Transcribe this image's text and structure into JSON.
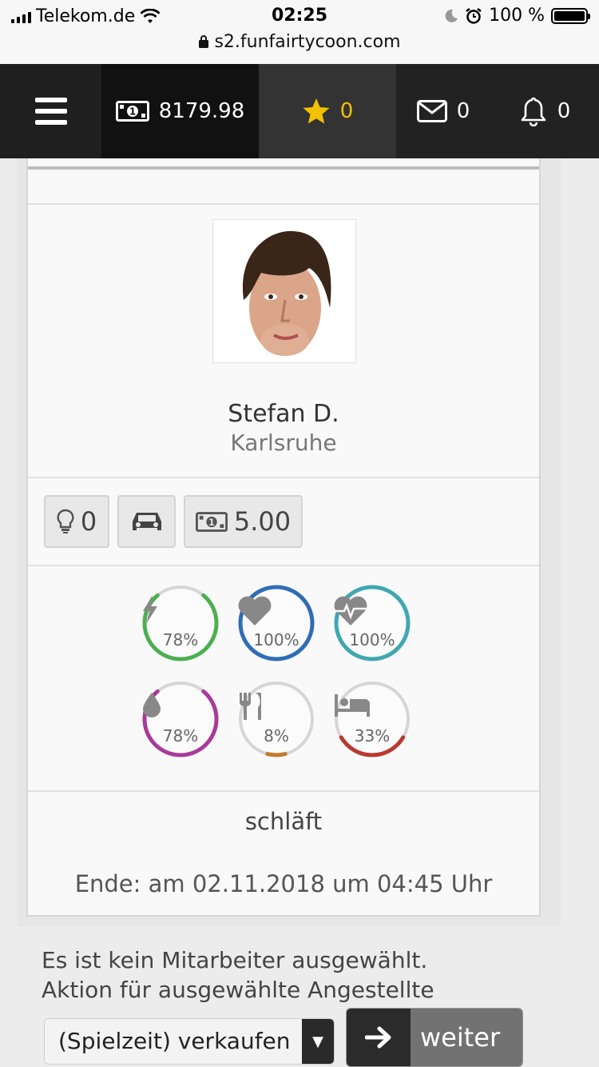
{
  "status_bar": {
    "carrier": "Telekom.de",
    "time": "02:25",
    "battery": "100 %",
    "url": "s2.funfairtycoon.com"
  },
  "nav": {
    "money": "8179.98",
    "stars": "0",
    "messages": "0",
    "notifications": "0"
  },
  "employee": {
    "name": "Stefan D.",
    "city": "Karlsruhe",
    "ideas": "0",
    "wage": "5.00",
    "state": "schläft",
    "end": "Ende: am 02.11.2018 um 04:45 Uhr"
  },
  "stats": [
    {
      "icon": "energy-icon",
      "label": "78%",
      "value": 0.78,
      "color": "#4caf50"
    },
    {
      "icon": "heart-icon",
      "label": "100%",
      "value": 1.0,
      "color": "#2f6db5"
    },
    {
      "icon": "heartbeat-icon",
      "label": "100%",
      "value": 1.0,
      "color": "#3fa7b1"
    },
    {
      "icon": "drop-icon",
      "label": "78%",
      "value": 0.78,
      "color": "#a83a9a"
    },
    {
      "icon": "food-icon",
      "label": "8%",
      "value": 0.08,
      "color": "#c47a2a"
    },
    {
      "icon": "bed-icon",
      "label": "33%",
      "value": 0.33,
      "color": "#b83a30"
    }
  ],
  "footer": {
    "line1": "Es ist kein Mitarbeiter ausgewählt.",
    "line2": "Aktion für ausgewählte Angestellte",
    "select_value": "(Spielzeit) verkaufen",
    "button_label": "weiter"
  }
}
